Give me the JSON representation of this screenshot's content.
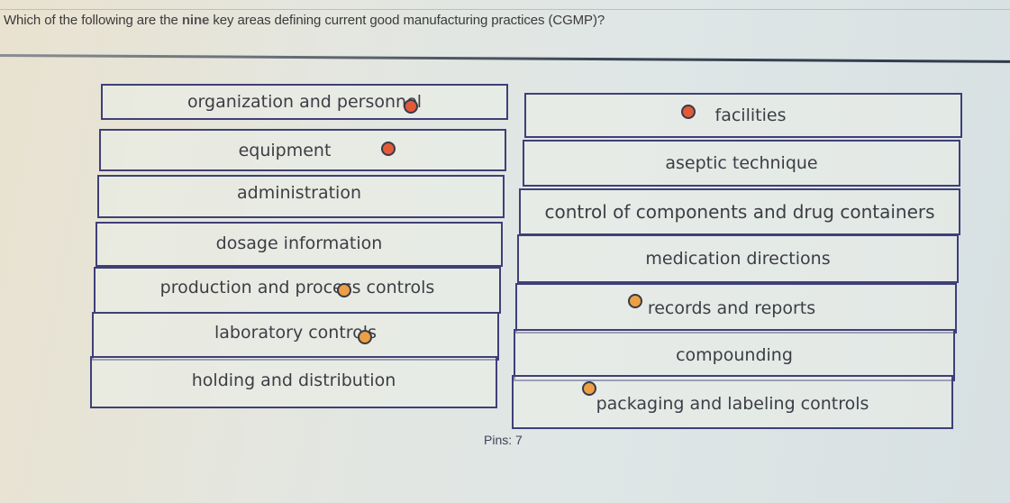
{
  "question": {
    "prefix": "Which of the following are the ",
    "emphasis": "nine",
    "suffix": " key areas defining current good manufacturing practices (CGMP)?"
  },
  "left_options": [
    {
      "label": "organization and personnel",
      "pin": "red"
    },
    {
      "label": "equipment",
      "pin": "red"
    },
    {
      "label": "administration",
      "pin": null
    },
    {
      "label": "dosage information",
      "pin": null
    },
    {
      "label": "production and process controls",
      "pin": "orange"
    },
    {
      "label": "laboratory controls",
      "pin": "orange"
    },
    {
      "label": "holding and distribution",
      "pin": null
    }
  ],
  "right_options": [
    {
      "label": "facilities",
      "pin": "red"
    },
    {
      "label": "aseptic technique",
      "pin": null
    },
    {
      "label": "control of components and drug containers",
      "pin": null
    },
    {
      "label": "medication directions",
      "pin": null
    },
    {
      "label": "records and reports",
      "pin": "orange"
    },
    {
      "label": "compounding",
      "pin": null
    },
    {
      "label": "packaging and labeling controls",
      "pin": "orange"
    }
  ],
  "pins": {
    "label": "Pins: 7",
    "count": 7,
    "colors": {
      "red": "#e25a3c",
      "orange": "#eba046"
    }
  }
}
